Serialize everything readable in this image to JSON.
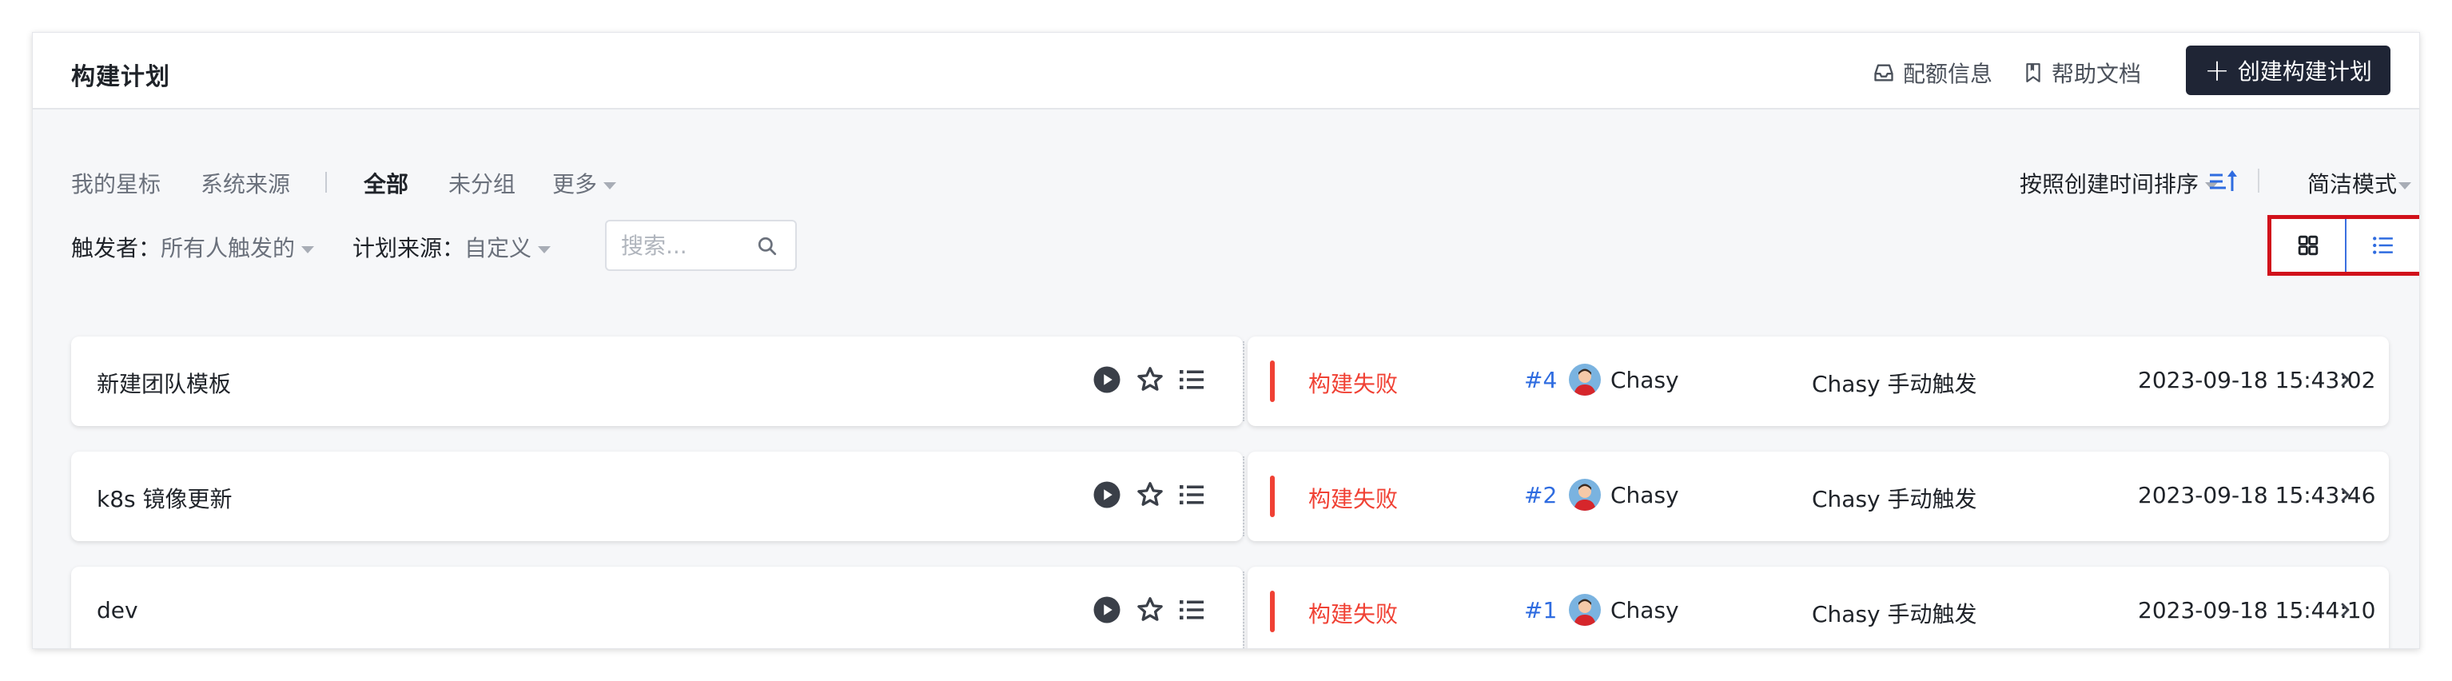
{
  "header": {
    "title": "构建计划",
    "quota_label": "配额信息",
    "help_label": "帮助文档",
    "create_label": "创建构建计划"
  },
  "tabs": [
    "我的星标",
    "系统来源",
    "全部",
    "未分组",
    "更多"
  ],
  "active_tab": "全部",
  "filters": {
    "trigger_label": "触发者：",
    "trigger_value": "所有人触发的",
    "source_label": "计划来源：",
    "source_value": "自定义",
    "search_placeholder": "搜索..."
  },
  "sort_label": "按照创建时间排序",
  "mode_label": "简洁模式",
  "view_modes": [
    "card",
    "list"
  ],
  "active_view": "list",
  "rows": [
    {
      "name": "新建团队模板",
      "status": "构建失败",
      "build": "#4",
      "user": "Chasy",
      "trigger": "Chasy 手动触发",
      "time": "2023-09-18 15:43:02"
    },
    {
      "name": "k8s 镜像更新",
      "status": "构建失败",
      "build": "#2",
      "user": "Chasy",
      "trigger": "Chasy 手动触发",
      "time": "2023-09-18 15:43:46"
    },
    {
      "name": "dev",
      "status": "构建失败",
      "build": "#1",
      "user": "Chasy",
      "trigger": "Chasy 手动触发",
      "time": "2023-09-18 15:44:10"
    }
  ],
  "colors": {
    "failed": "#f04134",
    "link": "#2f6ce0",
    "primary_button": "#1f2535",
    "highlight_box": "#d1111b"
  }
}
